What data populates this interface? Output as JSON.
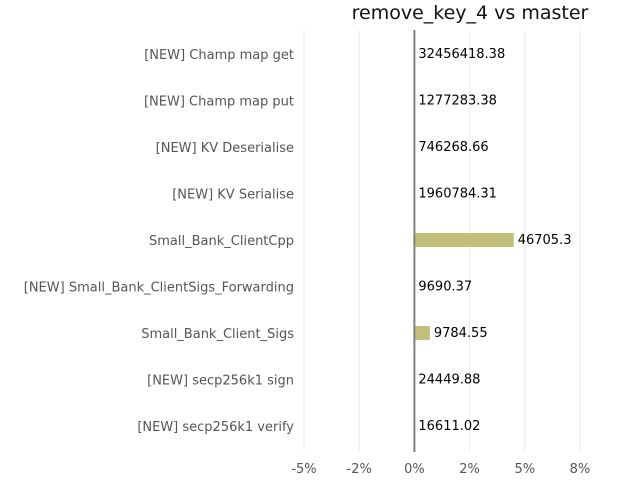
{
  "chart_data": {
    "type": "bar",
    "orientation": "horizontal",
    "title": "remove_key_4 vs master",
    "xlabel": "",
    "ylabel": "",
    "xlim": [
      -5,
      8
    ],
    "grid": true,
    "categories": [
      "[NEW] Champ map get",
      "[NEW] Champ map put",
      "[NEW] KV Deserialise",
      "[NEW] KV Serialise",
      "Small_Bank_ClientCpp",
      "[NEW] Small_Bank_ClientSigs_Forwarding",
      "Small_Bank_Client_Sigs",
      "[NEW] secp256k1 sign",
      "[NEW] secp256k1 verify"
    ],
    "values": [
      0,
      0,
      0,
      0,
      4.5,
      0,
      0.7,
      0,
      0
    ],
    "labels": [
      "32456418.38",
      "1277283.38",
      "746268.66",
      "1960784.31",
      "46705.3",
      "9690.37",
      "9784.55",
      "24449.88",
      "16611.02"
    ],
    "xticks": [
      -5,
      -2.5,
      0,
      2.5,
      5,
      7.5
    ],
    "xtick_labels": [
      "-5%",
      "-2%",
      "0%",
      "2%",
      "5%",
      "8%"
    ],
    "bar_color": "#c3bf7a",
    "zero_line_color": "#808080"
  }
}
